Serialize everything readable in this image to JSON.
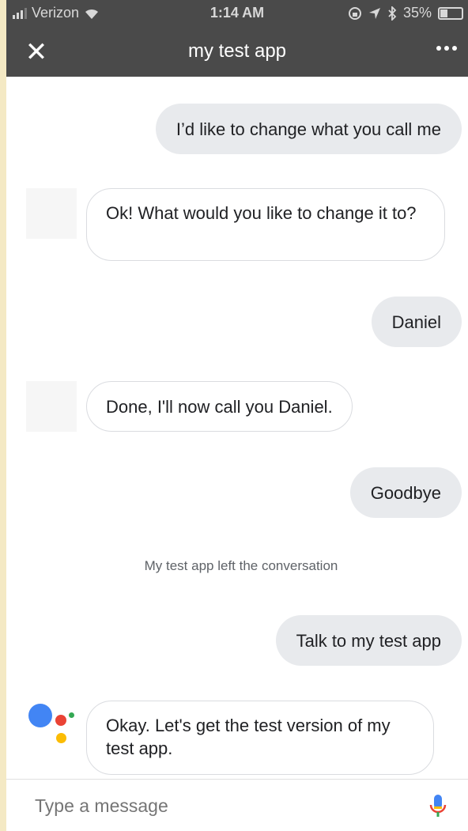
{
  "status_bar": {
    "carrier": "Verizon",
    "time": "1:14 AM",
    "battery_percent": "35%",
    "battery_level": 0.35,
    "icons": [
      "signal-icon",
      "wifi-icon",
      "lock-rotation-icon",
      "location-icon",
      "bluetooth-icon",
      "battery-icon"
    ]
  },
  "app_bar": {
    "title": "my test app",
    "close_icon": "close-icon",
    "more_icon": "more-icon"
  },
  "messages": [
    {
      "sender": "user",
      "text": "I’d like to change what you call me"
    },
    {
      "sender": "app",
      "text": "Ok! What would you like to change it to?"
    },
    {
      "sender": "user",
      "text": "Daniel"
    },
    {
      "sender": "app",
      "text": "Done, I'll now call you Daniel."
    },
    {
      "sender": "user",
      "text": "Goodbye"
    },
    {
      "sender": "system",
      "text": "My test app left the conversation"
    },
    {
      "sender": "user",
      "text": "Talk to my test app"
    },
    {
      "sender": "assistant",
      "text": "Okay. Let's get the test version of my test app."
    }
  ],
  "input": {
    "placeholder": "Type a message",
    "mic_icon": "mic-icon"
  },
  "colors": {
    "app_bar": "#4a4a4a",
    "user_bubble": "#e8eaed",
    "google_blue": "#4285f4",
    "google_red": "#ea4335",
    "google_yellow": "#fbbc04",
    "google_green": "#34a853"
  }
}
